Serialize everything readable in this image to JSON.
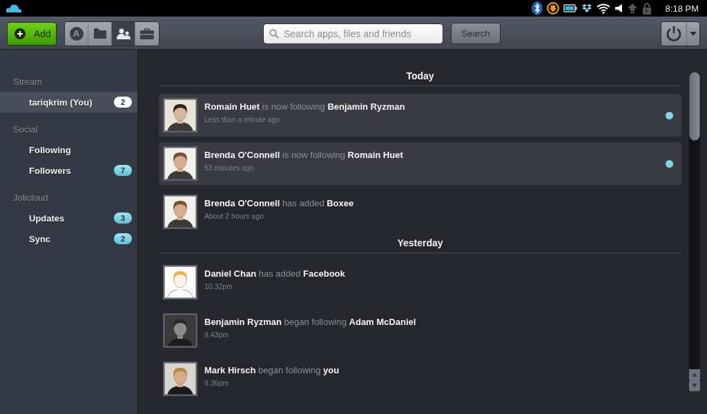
{
  "status_bar": {
    "lock_badge": "1",
    "time": "8:18 PM"
  },
  "toolbar": {
    "add_button": "Add",
    "view_tabs": [
      {
        "kind": "apps",
        "glyph": "A",
        "selected": false
      },
      {
        "kind": "files",
        "selected": false
      },
      {
        "kind": "people",
        "selected": true
      },
      {
        "kind": "work",
        "selected": false
      }
    ],
    "search": {
      "placeholder": "Search apps, files and friends"
    },
    "search_button": "Search"
  },
  "sidebar": {
    "sections": [
      {
        "title": "Stream",
        "items": [
          {
            "label": "tariqkrim (You)",
            "badge": "2",
            "selected": true
          }
        ]
      },
      {
        "title": "Social",
        "items": [
          {
            "label": "Following",
            "selected": false
          },
          {
            "label": "Followers",
            "badge": "7",
            "selected": false
          }
        ]
      },
      {
        "title": "Jolicloud",
        "items": [
          {
            "label": "Updates",
            "badge": "3",
            "selected": false
          },
          {
            "label": "Sync",
            "badge": "2",
            "selected": false
          }
        ]
      }
    ]
  },
  "feed": {
    "groups": [
      {
        "heading": "Today",
        "entries": [
          {
            "text": "**Romain Huet** is now following **Benjamin Ryzman**",
            "time": "Less than a minute ago",
            "unread": true
          },
          {
            "text": "**Brenda O'Connell** is now following **Romain Huet**",
            "time": "53 minutes ago",
            "unread": true
          },
          {
            "text": "**Brenda O'Connell** has added **Boxee**",
            "time": "About 2 hours ago",
            "unread": false
          }
        ]
      },
      {
        "heading": "Yesterday",
        "entries": [
          {
            "text": "**Daniel Chan** has added **Facebook**",
            "time": "10.32pm",
            "unread": false
          },
          {
            "text": "**Benjamin Ryzman** began following **Adam McDaniel**",
            "time": "9.43pm",
            "unread": false
          },
          {
            "text": "**Mark Hirsch** began following **you**",
            "time": "9.36pm",
            "unread": false
          }
        ]
      }
    ]
  }
}
